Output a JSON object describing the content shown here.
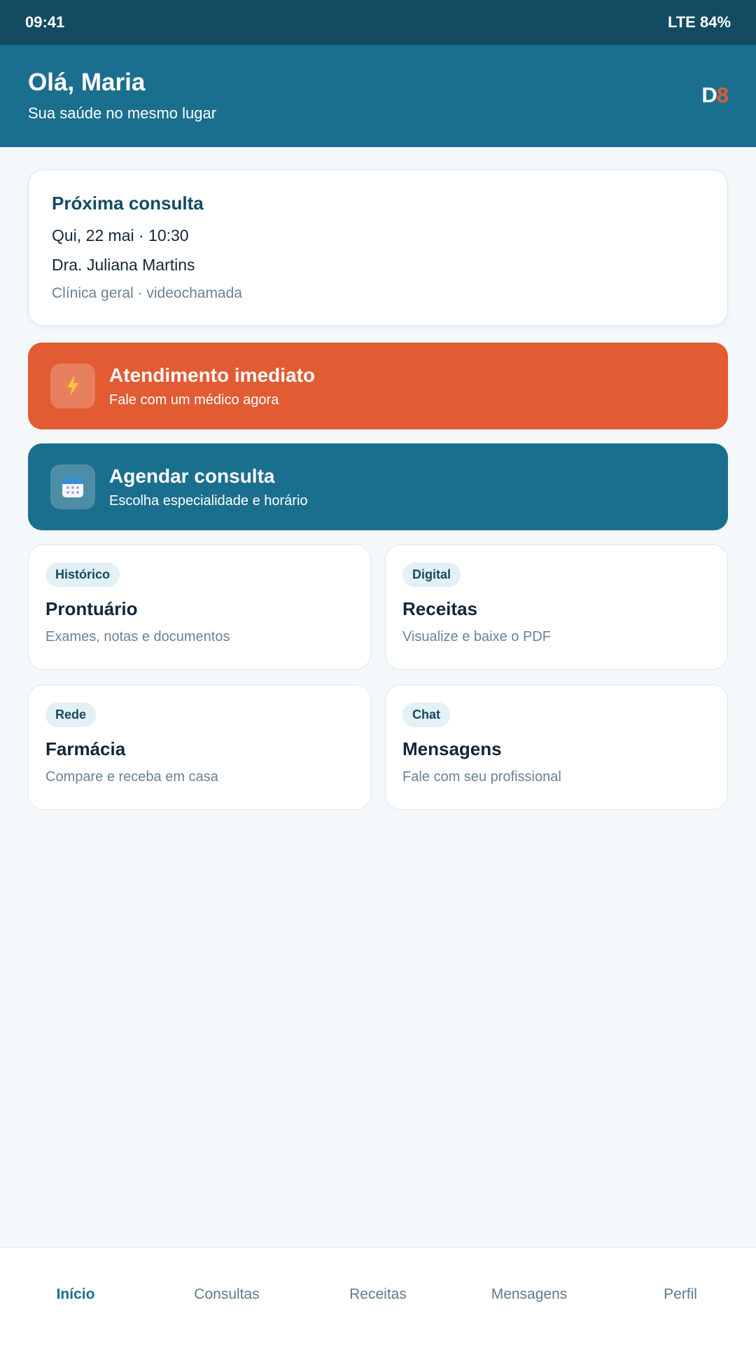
{
  "status_bar": {
    "time": "09:41",
    "signal": "LTE 84%"
  },
  "header": {
    "greeting": "Olá, Maria",
    "subtitle": "Sua saúde no mesmo lugar",
    "brand_d": "D",
    "brand_8": "8"
  },
  "next_appointment": {
    "title": "Próxima consulta",
    "date": "Qui, 22 mai · 10:30",
    "doctor": "Dra. Juliana Martins",
    "type": "Clínica geral · videochamada"
  },
  "actions": [
    {
      "title": "Atendimento imediato",
      "subtitle": "Fale com um médico agora",
      "icon": "lightning-icon",
      "color": "#e25b32"
    },
    {
      "title": "Agendar consulta",
      "subtitle": "Escolha especialidade e horário",
      "icon": "calendar-icon",
      "color": "#1b6f8e"
    }
  ],
  "tiles": [
    {
      "badge": "Histórico",
      "title": "Prontuário",
      "subtitle": "Exames, notas e documentos"
    },
    {
      "badge": "Digital",
      "title": "Receitas",
      "subtitle": "Visualize e baixe o PDF"
    },
    {
      "badge": "Rede",
      "title": "Farmácia",
      "subtitle": "Compare e receba em casa"
    },
    {
      "badge": "Chat",
      "title": "Mensagens",
      "subtitle": "Fale com seu profissional"
    }
  ],
  "nav": {
    "items": [
      "Início",
      "Consultas",
      "Receitas",
      "Mensagens",
      "Perfil"
    ],
    "active": "Início"
  },
  "colors": {
    "primary": "#1b6f8e",
    "primary_dark": "#134b62",
    "accent": "#e25b32",
    "background": "#f4f8fb"
  }
}
